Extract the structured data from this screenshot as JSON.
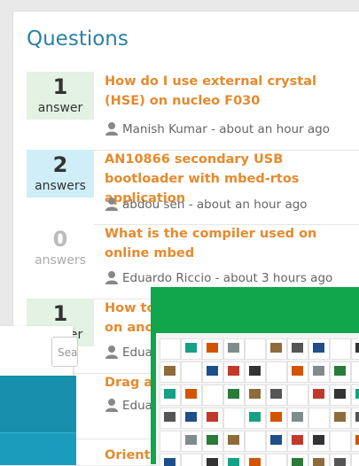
{
  "panel": {
    "title": "Questions"
  },
  "questions": [
    {
      "count": "1",
      "label": "answer",
      "title": "How do I use external crystal (HSE) on nucleo F030",
      "meta": "Manish Kumar - about an hour ago"
    },
    {
      "count": "2",
      "label": "answers",
      "title": "AN10866 secondary USB bootloader with mbed-rtos application",
      "meta": "abdou sen - about an hour ago"
    },
    {
      "count": "0",
      "label": "answers",
      "title": "What is the compiler used on online mbed",
      "meta": "Eduardo Riccio - about 3 hours ago"
    },
    {
      "count": "1",
      "label": "answer",
      "title": "How to",
      "title2": "on ano",
      "meta": "Edua"
    },
    {
      "count": "",
      "label": "",
      "title": "Drag a",
      "meta": "Edua"
    },
    {
      "count": "",
      "label": "",
      "title": "Orient",
      "meta": ""
    }
  ],
  "overlays": {
    "search_placeholder": "Sea"
  },
  "colors": {
    "title_blue": "#2b80a8",
    "link_orange": "#e58a2e",
    "green": "#0fa64c",
    "teal": "#1690ad"
  }
}
